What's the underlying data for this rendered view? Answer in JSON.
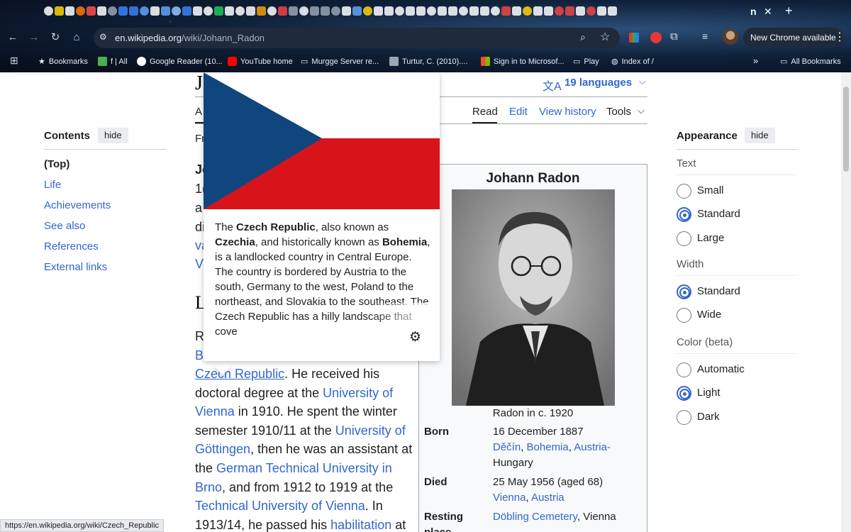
{
  "tabstrip": {
    "active_tab_char": "n",
    "close_glyph": "✕",
    "new_tab_glyph": "+"
  },
  "toolbar": {
    "url_domain": "en.wikipedia.org",
    "url_path": "/wiki/Johann_Radon",
    "new_chrome_label": "New Chrome available"
  },
  "bookmarks": {
    "items": [
      {
        "label": "Bookmarks",
        "icon": "star-icon"
      },
      {
        "label": "f | All",
        "icon": "feed-icon"
      },
      {
        "label": "Google Reader (10...",
        "icon": "google-icon"
      },
      {
        "label": "YouTube home",
        "icon": "youtube-icon"
      },
      {
        "label": "Murgge Server re...",
        "icon": "folder-icon"
      },
      {
        "label": "Turtur, C. (2010)....",
        "icon": "page-icon"
      },
      {
        "label": "Sign in to Microsof...",
        "icon": "microsoft-icon"
      },
      {
        "label": "Play",
        "icon": "folder-icon"
      },
      {
        "label": "Index of /",
        "icon": "globe-icon"
      }
    ],
    "overflow_glyph": "»",
    "all_bookmarks_label": "All Bookmarks"
  },
  "toc": {
    "title": "Contents",
    "hide_label": "hide",
    "items": [
      "(Top)",
      "Life",
      "Achievements",
      "See also",
      "References",
      "External links"
    ]
  },
  "article": {
    "title_fragment": "J",
    "languages_label": "19 languages",
    "tab_article_fragment": "A",
    "tabs": [
      "Read",
      "Edit",
      "View history",
      "Tools"
    ],
    "from_fragment": "Fr",
    "left_fragments": [
      "Jo",
      "1(",
      "a",
      "di",
      "va",
      "V"
    ],
    "section_heading_fragment": "L",
    "life_r_fragment": "R",
    "life_b_fragment": "B",
    "body_lines": [
      {
        "before": "",
        "link": "Czech Republic",
        "after": ". He received his",
        "underline": true
      },
      {
        "before": "doctoral degree at the ",
        "link": "University of",
        "after": ""
      },
      {
        "before": "",
        "link": "Vienna",
        "after": " in 1910. He spent the winter"
      },
      {
        "before": "semester 1910/11 at the ",
        "link": "University of",
        "after": ""
      },
      {
        "before": "",
        "link": "Göttingen",
        "after": ", then he was an assistant at"
      },
      {
        "before": "the ",
        "link": "German Technical University in",
        "after": ""
      },
      {
        "before": "",
        "link": "Brno",
        "after": ", and from 1912 to 1919 at the"
      },
      {
        "before": "",
        "link": "Technical University of Vienna",
        "after": ". In"
      },
      {
        "before": "1913/14, he passed his ",
        "link": "habilitation",
        "after": " at"
      }
    ]
  },
  "infobox": {
    "name": "Johann Radon",
    "caption": "Radon in c. 1920",
    "born_label": "Born",
    "born_date": "16 December 1887",
    "born_place_1": "Děčín",
    "born_place_2": "Bohemia",
    "born_place_3": "Austria-",
    "born_place_4": "Hungary",
    "died_label": "Died",
    "died_date": "25 May 1956 (aged 68)",
    "died_place_1": "Vienna",
    "died_place_2": "Austria",
    "resting_label_1": "Resting",
    "resting_label_2": "place",
    "resting_place": "Döbling Cemetery",
    "resting_city": ", Vienna"
  },
  "appearance": {
    "title": "Appearance",
    "hide_label": "hide",
    "groups": [
      {
        "label": "Text",
        "options": [
          "Small",
          "Standard",
          "Large"
        ],
        "selected": "Standard"
      },
      {
        "label": "Width",
        "options": [
          "Standard",
          "Wide"
        ],
        "selected": "Standard"
      },
      {
        "label": "Color (beta)",
        "options": [
          "Automatic",
          "Light",
          "Dark"
        ],
        "selected": "Light"
      }
    ]
  },
  "popup": {
    "subject": "Czech Republic",
    "text_parts": {
      "p1": "The ",
      "b1": "Czech Republic",
      "p2": ", also known as ",
      "b2": "Czechia",
      "p3": ", and historically known as ",
      "b3": "Bohemia",
      "p4": ", is a landlocked country in Central Europe. The country is bordered by Austria to the south, Germany to the west, Poland to the northeast, and Slovakia to the southeast. The Czech Republic has a hilly landscape that cove"
    },
    "flag_colors": {
      "blue": "#11457e",
      "white": "#ffffff",
      "red": "#d7141a"
    }
  },
  "status_bar": {
    "url": "https://en.wikipedia.org/wiki/Czech_Republic"
  },
  "colors": {
    "link": "#3366cc",
    "text": "#202122",
    "accent_radio": "#3366cc"
  }
}
